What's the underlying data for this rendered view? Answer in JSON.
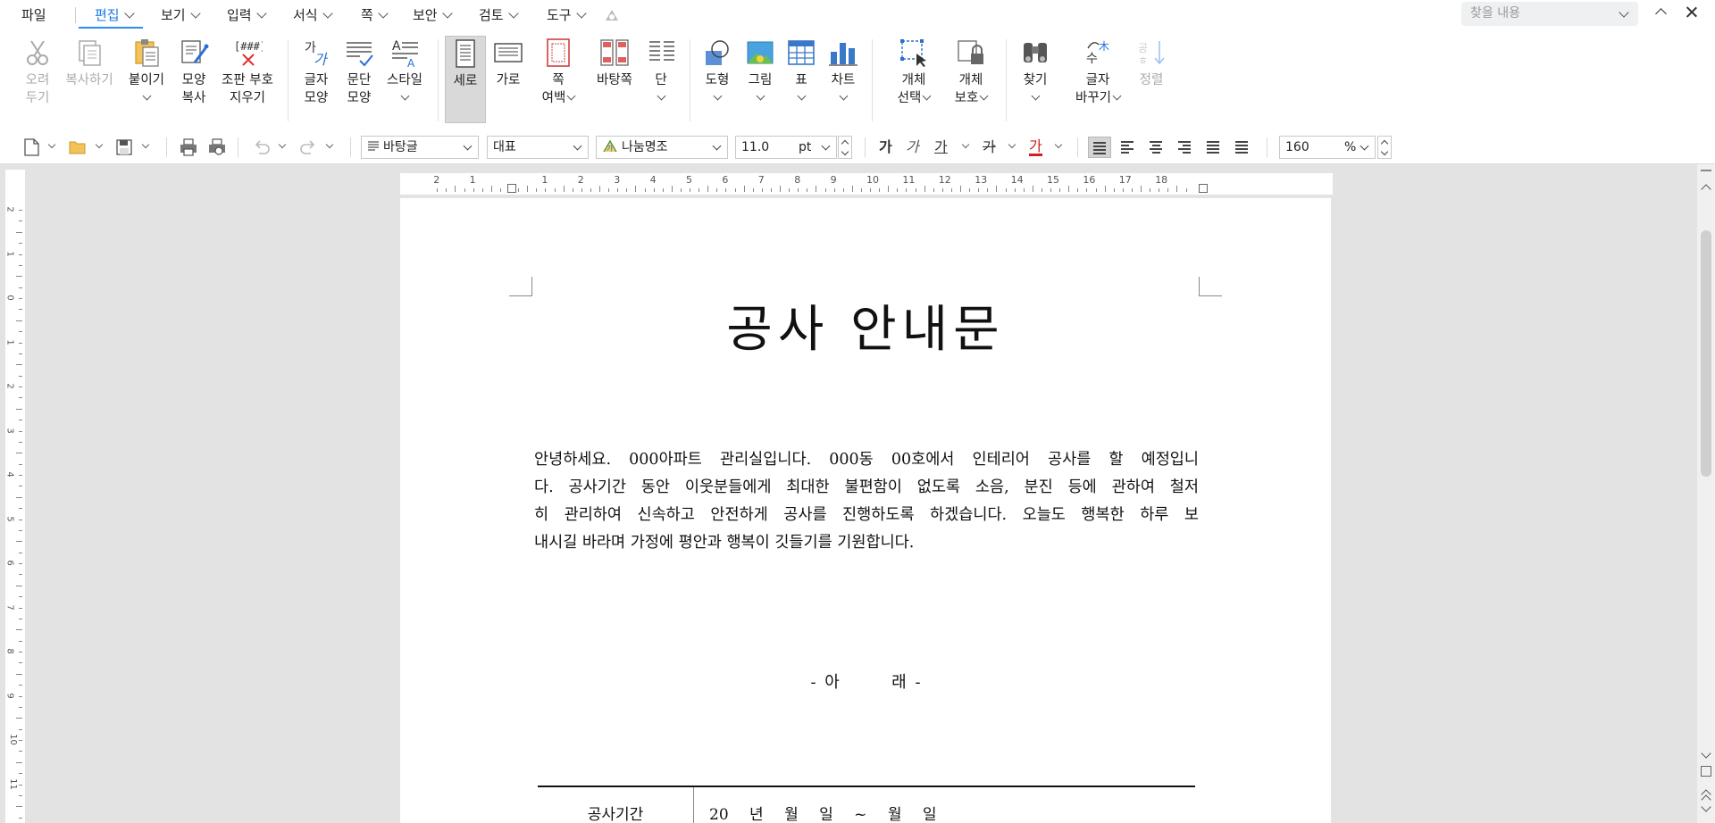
{
  "menu": {
    "file": "파일",
    "items": [
      "편집",
      "보기",
      "입력",
      "서식",
      "쪽",
      "보안",
      "검토",
      "도구"
    ],
    "search_placeholder": "찾을 내용"
  },
  "ribbon": {
    "cut": [
      "오려",
      "두기"
    ],
    "copy": "복사하기",
    "paste": "붙이기",
    "format_painter": [
      "모양",
      "복사"
    ],
    "clear_marks": [
      "조판 부호",
      "지우기"
    ],
    "char_shape": [
      "글자",
      "모양"
    ],
    "para_shape": [
      "문단",
      "모양"
    ],
    "style": "스타일",
    "portrait": "세로",
    "landscape": "가로",
    "margin": [
      "쪽",
      "여백"
    ],
    "master_page": "바탕쪽",
    "columns": "단",
    "shape": "도형",
    "picture": "그림",
    "table": "표",
    "chart": "차트",
    "object_select": [
      "개체",
      "선택"
    ],
    "object_protect": [
      "개체",
      "보호"
    ],
    "find": "찾기",
    "replace": [
      "글자",
      "바꾸기"
    ],
    "sort": "정렬"
  },
  "toolbar": {
    "style_combo": "바탕글",
    "lang_combo": "대표",
    "font_combo": "나눔명조",
    "size_value": "11.0",
    "size_unit": "pt",
    "zoom_value": "160",
    "zoom_unit": "%",
    "bold": "가",
    "italic": "가",
    "underline": "가",
    "strike": "가",
    "color": "가"
  },
  "ruler": {
    "h_numbers": [
      "2",
      "1",
      "1",
      "2",
      "3",
      "4",
      "5",
      "6",
      "7",
      "8",
      "9",
      "10",
      "11",
      "12",
      "13",
      "14",
      "15",
      "16",
      "17",
      "18"
    ],
    "v_numbers": [
      "2",
      "1",
      "0",
      "1",
      "2",
      "3",
      "4",
      "5",
      "6",
      "7",
      "8",
      "9",
      "10",
      "11"
    ]
  },
  "document": {
    "title": "공사 안내문",
    "body_lines": [
      "안녕하세요. 000아파트 관리실입니다. 000동 00호에서 인테리어 공사를 할 예정입니",
      "다. 공사기간 동안 이웃분들에게 최대한 불편함이 없도록 소음, 분진 등에 관하여 철저",
      "히 관리하여 신속하고 안전하게 공사를 진행하도록 하겠습니다. 오늘도 행복한 하루 보",
      "내시길 바라며 가정에 평안과 행복이 깃들기를 기원합니다."
    ],
    "subheading": "- 아      래 -",
    "table_head": "공사기간",
    "table_value": "20 년 월 일 ~ 월 일"
  }
}
